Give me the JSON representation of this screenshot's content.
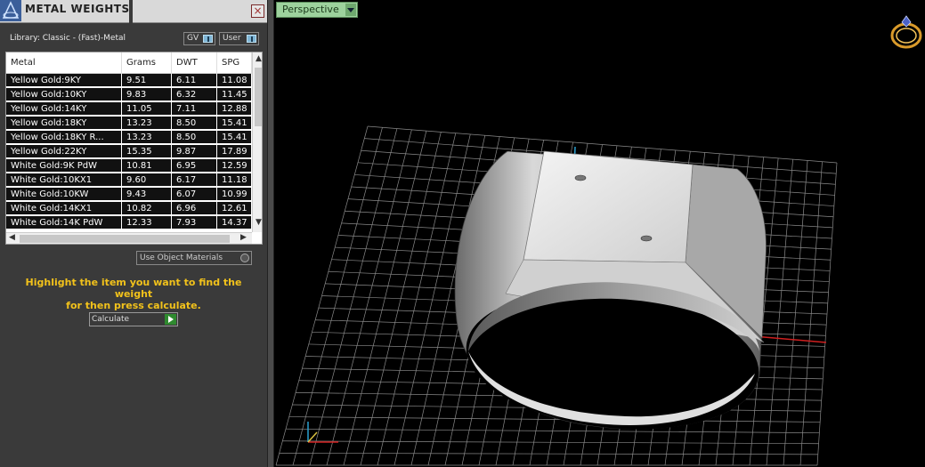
{
  "panel": {
    "title": "METAL WEIGHTS",
    "close_label": "×",
    "library_text": "Library: Classic - (Fast)-Metal",
    "toggle_gv": "GV",
    "toggle_user": "User",
    "use_object_materials": "Use Object Materials",
    "hint_line1": "Highlight the item you want to find the weight",
    "hint_line2": "for then press calculate.",
    "calculate_label": "Calculate"
  },
  "table": {
    "columns": [
      "Metal",
      "Grams",
      "DWT",
      "SPG"
    ],
    "rows": [
      [
        "Yellow Gold:9KY",
        "9.51",
        "6.11",
        "11.08"
      ],
      [
        "Yellow Gold:10KY",
        "9.83",
        "6.32",
        "11.45"
      ],
      [
        "Yellow Gold:14KY",
        "11.05",
        "7.11",
        "12.88"
      ],
      [
        "Yellow Gold:18KY",
        "13.23",
        "8.50",
        "15.41"
      ],
      [
        "Yellow Gold:18KY R...",
        "13.23",
        "8.50",
        "15.41"
      ],
      [
        "Yellow Gold:22KY",
        "15.35",
        "9.87",
        "17.89"
      ],
      [
        "White Gold:9K PdW",
        "10.81",
        "6.95",
        "12.59"
      ],
      [
        "White Gold:10KX1",
        "9.60",
        "6.17",
        "11.18"
      ],
      [
        "White Gold:10KW",
        "9.43",
        "6.07",
        "10.99"
      ],
      [
        "White Gold:14KX1",
        "10.82",
        "6.96",
        "12.61"
      ],
      [
        "White Gold:14K PdW",
        "12.33",
        "7.93",
        "14.37"
      ]
    ]
  },
  "viewport": {
    "view_label": "Perspective"
  },
  "colors": {
    "hint": "#f2c21b",
    "view_button": "#9dd29d",
    "axis_x": "#d02020",
    "axis_y": "#2aa0d0"
  }
}
